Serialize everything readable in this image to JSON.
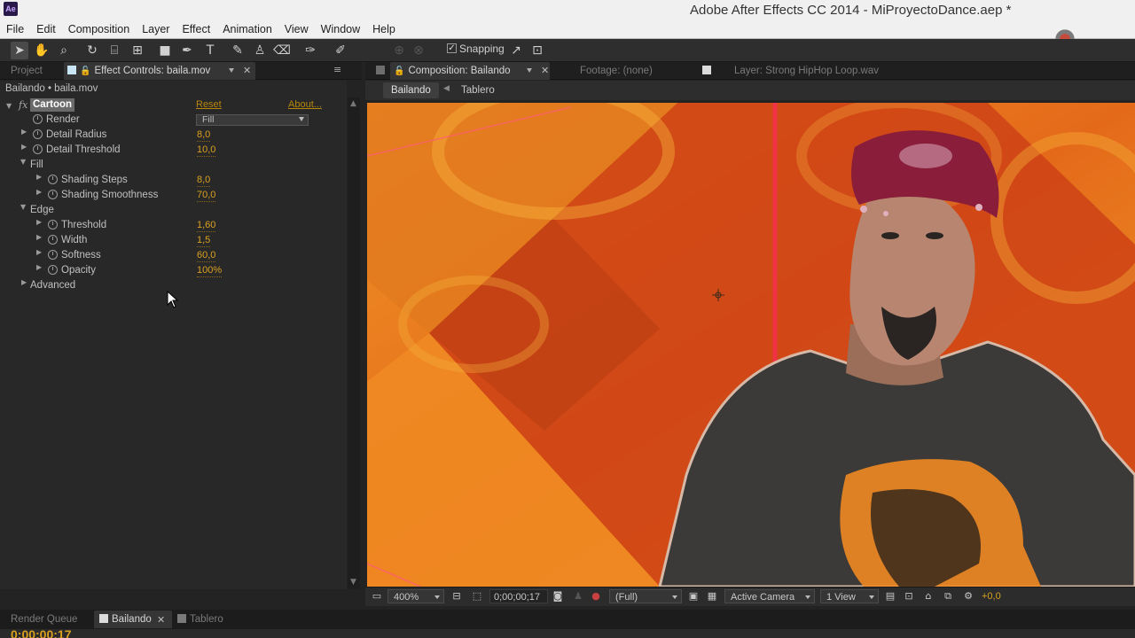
{
  "app": {
    "logo": "Ae",
    "window_title": "Adobe After Effects CC 2014 - MiProyectoDance.aep *"
  },
  "menu": [
    "File",
    "Edit",
    "Composition",
    "Layer",
    "Effect",
    "Animation",
    "View",
    "Window",
    "Help"
  ],
  "toolbar": {
    "tools": [
      "selection-tool-icon",
      "hand-tool-icon",
      "zoom-tool-icon",
      "rotate-tool-icon",
      "camera-tool-icon",
      "pan-behind-tool-icon",
      "rectangle-tool-icon",
      "pen-tool-icon",
      "type-tool-icon",
      "brush-tool-icon",
      "clone-stamp-tool-icon",
      "eraser-tool-icon",
      "roto-brush-tool-icon",
      "puppet-pin-tool-icon"
    ],
    "snapping_label": "Snapping",
    "snapping_checked": true
  },
  "left_panel": {
    "tabs": {
      "project": "Project",
      "effect_controls": "Effect Controls: baila.mov"
    },
    "layer_path": "Bailando • baila.mov",
    "effect": {
      "fx": "fx",
      "name": "Cartoon",
      "reset": "Reset",
      "about": "About..."
    },
    "render": {
      "label": "Render",
      "value": "Fill"
    },
    "rows": {
      "detail_radius": {
        "label": "Detail Radius",
        "value": "8,0"
      },
      "detail_threshold": {
        "label": "Detail Threshold",
        "value": "10,0"
      },
      "fill_group": "Fill",
      "shading_steps": {
        "label": "Shading Steps",
        "value": "8,0"
      },
      "shading_smoothness": {
        "label": "Shading Smoothness",
        "value": "70,0"
      },
      "edge_group": "Edge",
      "threshold": {
        "label": "Threshold",
        "value": "1,60"
      },
      "width": {
        "label": "Width",
        "value": "1,5"
      },
      "softness": {
        "label": "Softness",
        "value": "60,0"
      },
      "opacity": {
        "label": "Opacity",
        "value": "100%"
      },
      "advanced_group": "Advanced"
    }
  },
  "comp_panel": {
    "tabs": {
      "composition": "Composition: Bailando",
      "footage": "Footage: (none)",
      "layer": "Layer: Strong HipHop Loop.wav"
    },
    "subtabs": {
      "bailando": "Bailando",
      "tablero": "Tablero"
    },
    "viewer_bar": {
      "zoom": "400%",
      "timecode": "0;00;00;17",
      "resolution": "(Full)",
      "camera": "Active Camera",
      "views": "1 View",
      "exposure": "+0,0"
    }
  },
  "timeline": {
    "tabs": {
      "render_queue": "Render Queue",
      "bailando": "Bailando",
      "tablero": "Tablero"
    },
    "timecode": "0;00;00;17"
  },
  "colors": {
    "value_orange": "#d9a020",
    "comp_label": "#c9c9c9",
    "viewer_orange": "#e8661a",
    "viewer_red": "#c93a12"
  }
}
